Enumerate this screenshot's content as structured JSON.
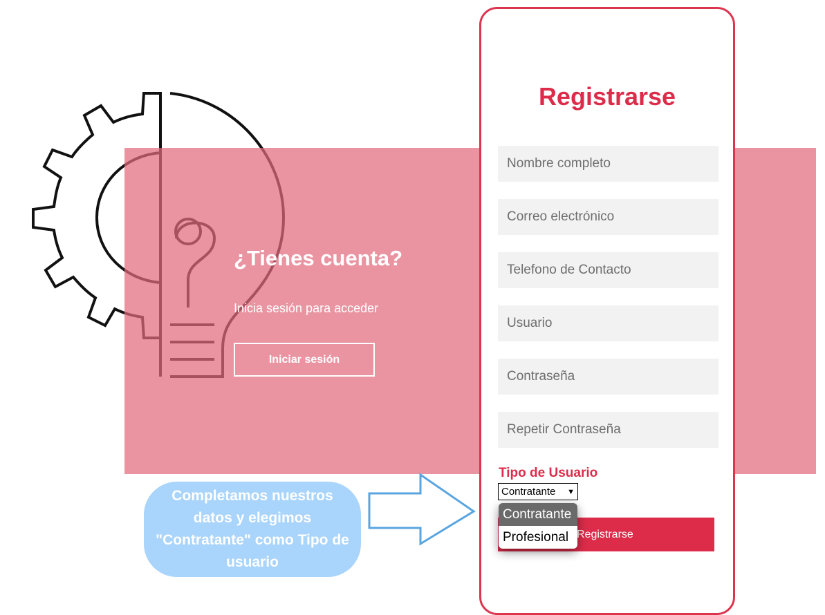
{
  "login": {
    "title": "¿Tienes cuenta?",
    "subtitle": "Inicia sesión para acceder",
    "button_label": "Iniciar sesión"
  },
  "register": {
    "title": "Registrarse",
    "fields": {
      "full_name_placeholder": "Nombre completo",
      "email_placeholder": "Correo electrónico",
      "phone_placeholder": "Telefono de Contacto",
      "username_placeholder": "Usuario",
      "password_placeholder": "Contraseña",
      "repeat_password_placeholder": "Repetir Contraseña"
    },
    "user_type_label": "Tipo de Usuario",
    "user_type_selected": "Contratante",
    "user_type_options": [
      "Contratante",
      "Profesional"
    ],
    "submit_label": "Registrarse"
  },
  "annotation": {
    "callout_text": "Completamos nuestros datos y elegimos \"Contratante\" como Tipo de usuario",
    "arrow_icon": "right-arrow-outline-icon"
  },
  "icons": {
    "logo": "gear-lightbulb-logo-icon",
    "dropdown": "chevron-down-icon"
  },
  "colors": {
    "accent": "#dc2c4a",
    "band": "#e26b7e",
    "callout": "#a9d4fb",
    "arrow": "#5aa5e0",
    "field_bg": "#f2f2f2"
  }
}
